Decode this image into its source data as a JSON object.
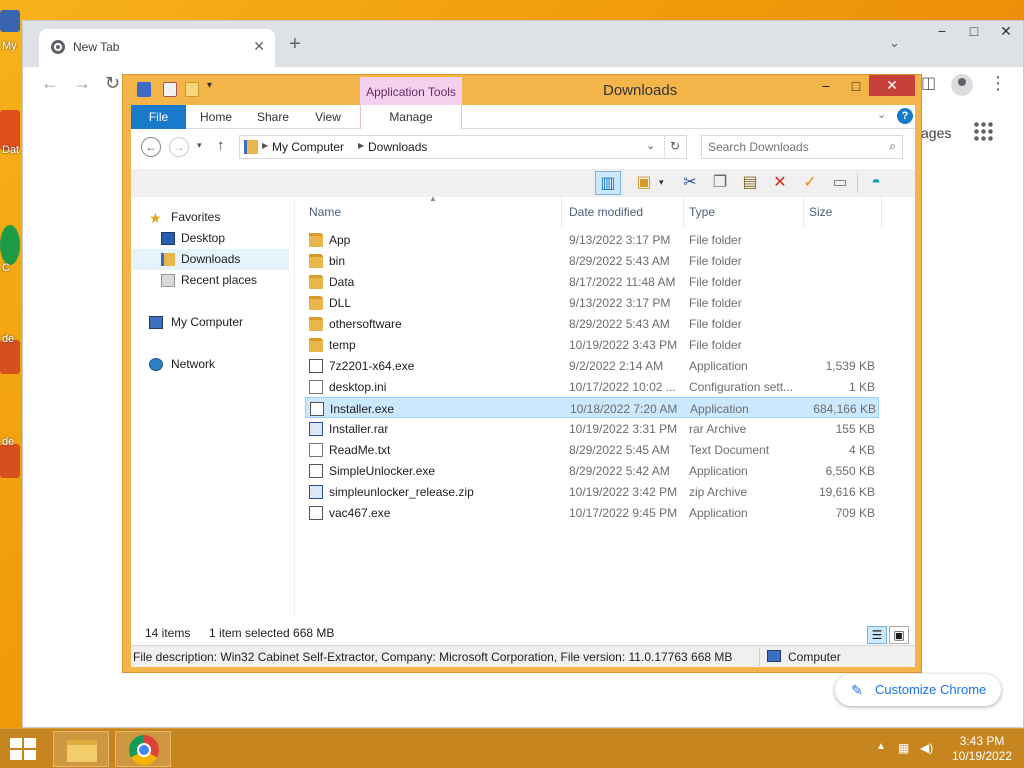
{
  "chrome": {
    "tab_title": "New Tab",
    "tab_close": "✕",
    "new_tab": "+",
    "ntp_images_partial": "ages",
    "customize_label": "Customize Chrome"
  },
  "desktop": {
    "labels": [
      "My",
      "Dat",
      "C",
      "de",
      "de"
    ]
  },
  "explorer": {
    "title": "Downloads",
    "context_tab": "Application Tools",
    "ribbon_tabs": [
      "File",
      "Home",
      "Share",
      "View",
      "Manage"
    ],
    "help": "?",
    "address": {
      "crumbs": [
        "My Computer",
        "Downloads"
      ]
    },
    "search_placeholder": "Search Downloads",
    "nav": {
      "favorites": "Favorites",
      "desktop": "Desktop",
      "downloads": "Downloads",
      "recent": "Recent places",
      "computer": "My Computer",
      "network": "Network"
    },
    "columns": {
      "name": "Name",
      "date": "Date modified",
      "type": "Type",
      "size": "Size"
    },
    "files": [
      {
        "name": "App",
        "date": "9/13/2022 3:17 PM",
        "type": "File folder",
        "size": "",
        "icon": "folder-icon",
        "selected": false
      },
      {
        "name": "bin",
        "date": "8/29/2022 5:43 AM",
        "type": "File folder",
        "size": "",
        "icon": "folder-icon",
        "selected": false
      },
      {
        "name": "Data",
        "date": "8/17/2022 11:48 AM",
        "type": "File folder",
        "size": "",
        "icon": "folder-icon",
        "selected": false
      },
      {
        "name": "DLL",
        "date": "9/13/2022 3:17 PM",
        "type": "File folder",
        "size": "",
        "icon": "folder-icon",
        "selected": false
      },
      {
        "name": "othersoftware",
        "date": "8/29/2022 5:43 AM",
        "type": "File folder",
        "size": "",
        "icon": "folder-icon",
        "selected": false
      },
      {
        "name": "temp",
        "date": "10/19/2022 3:43 PM",
        "type": "File folder",
        "size": "",
        "icon": "folder-icon",
        "selected": false
      },
      {
        "name": "7z2201-x64.exe",
        "date": "9/2/2022 2:14 AM",
        "type": "Application",
        "size": "1,539 KB",
        "icon": "7zip-icon",
        "selected": false
      },
      {
        "name": "desktop.ini",
        "date": "10/17/2022 10:02 ...",
        "type": "Configuration sett...",
        "size": "1 KB",
        "icon": "settings-file-icon",
        "selected": false
      },
      {
        "name": "Installer.exe",
        "date": "10/18/2022 7:20 AM",
        "type": "Application",
        "size": "684,166 KB",
        "icon": "installer-icon",
        "selected": true
      },
      {
        "name": "Installer.rar",
        "date": "10/19/2022 3:31 PM",
        "type": "rar Archive",
        "size": "155 KB",
        "icon": "rar-archive-icon",
        "selected": false
      },
      {
        "name": "ReadMe.txt",
        "date": "8/29/2022 5:45 AM",
        "type": "Text Document",
        "size": "4 KB",
        "icon": "text-file-icon",
        "selected": false
      },
      {
        "name": "SimpleUnlocker.exe",
        "date": "8/29/2022 5:42 AM",
        "type": "Application",
        "size": "6,550 KB",
        "icon": "unlocker-icon",
        "selected": false
      },
      {
        "name": "simpleunlocker_release.zip",
        "date": "10/19/2022 3:42 PM",
        "type": "zip Archive",
        "size": "19,616 KB",
        "icon": "zip-archive-icon",
        "selected": false
      },
      {
        "name": "vac467.exe",
        "date": "10/17/2022 9:45 PM",
        "type": "Application",
        "size": "709 KB",
        "icon": "application-icon",
        "selected": false
      }
    ],
    "status": {
      "count": "14 items",
      "selection": "1 item selected  668 MB"
    },
    "description": "File description: Win32 Cabinet Self-Extractor, Company: Microsoft Corporation, File version: 11.0.17763 668 MB",
    "location": "Computer"
  },
  "taskbar": {
    "time": "3:43 PM",
    "date": "10/19/2022"
  },
  "colors": {
    "accent": "#1979ca",
    "window_frame": "#f3b54a",
    "selection": "#cce8ff",
    "close_red": "#c7413a"
  }
}
